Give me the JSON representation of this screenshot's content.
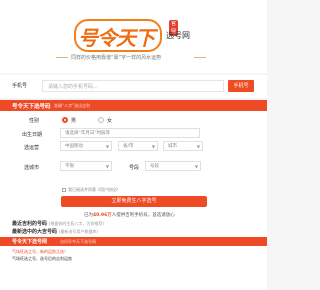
{
  "brand": {
    "logo_text": "号令天下",
    "badge": "官网",
    "sub_title": "选号网",
    "slogan": "同样的价格用靠谱“靠”字一样的风水运势"
  },
  "search": {
    "label": "手机号",
    "placeholder": "请输入您的手机号码...",
    "button": "手机号"
  },
  "form": {
    "title": "号令天下选号码",
    "note": "准确“八字”选出吉利",
    "gender_label": "性别",
    "gender_options": [
      "男",
      "女"
    ],
    "birth_label": "出生日期",
    "birth_placeholder": "请选择“年月日”时辰等",
    "operator_label": "选运营",
    "operator_value": "中国移动",
    "province_label": "省",
    "province_value": "省/市",
    "city_label": "市",
    "city_value": "城市",
    "area_label": "选城市",
    "area_value": "不限",
    "number_label": "号段",
    "number_value": "号段",
    "agree_text": "我已阅读并同意《用户协议》",
    "submit": "立即免费生八字选号",
    "stats_prefix": "已为",
    "stats_count": "40.96万",
    "stats_suffix": "人提供吉利手机号，首选请放心"
  },
  "sections": {
    "new_title": "最近吉利的号码",
    "new_sub": "(根据你的生辰八字，为你推荐)",
    "latest_title": "最新选中的大吉号码",
    "latest_sub": "(最新选号用户数据库)"
  },
  "ad": {
    "title": "号令天下选号网",
    "link": "访问号令天下选号网",
    "line1": "气场旺选之号、新的运势之选！",
    "line2": "气场旺选之号、选号后的吉利运势"
  },
  "colors": {
    "accent": "#ee4a26",
    "logo": "#ef6c12"
  }
}
